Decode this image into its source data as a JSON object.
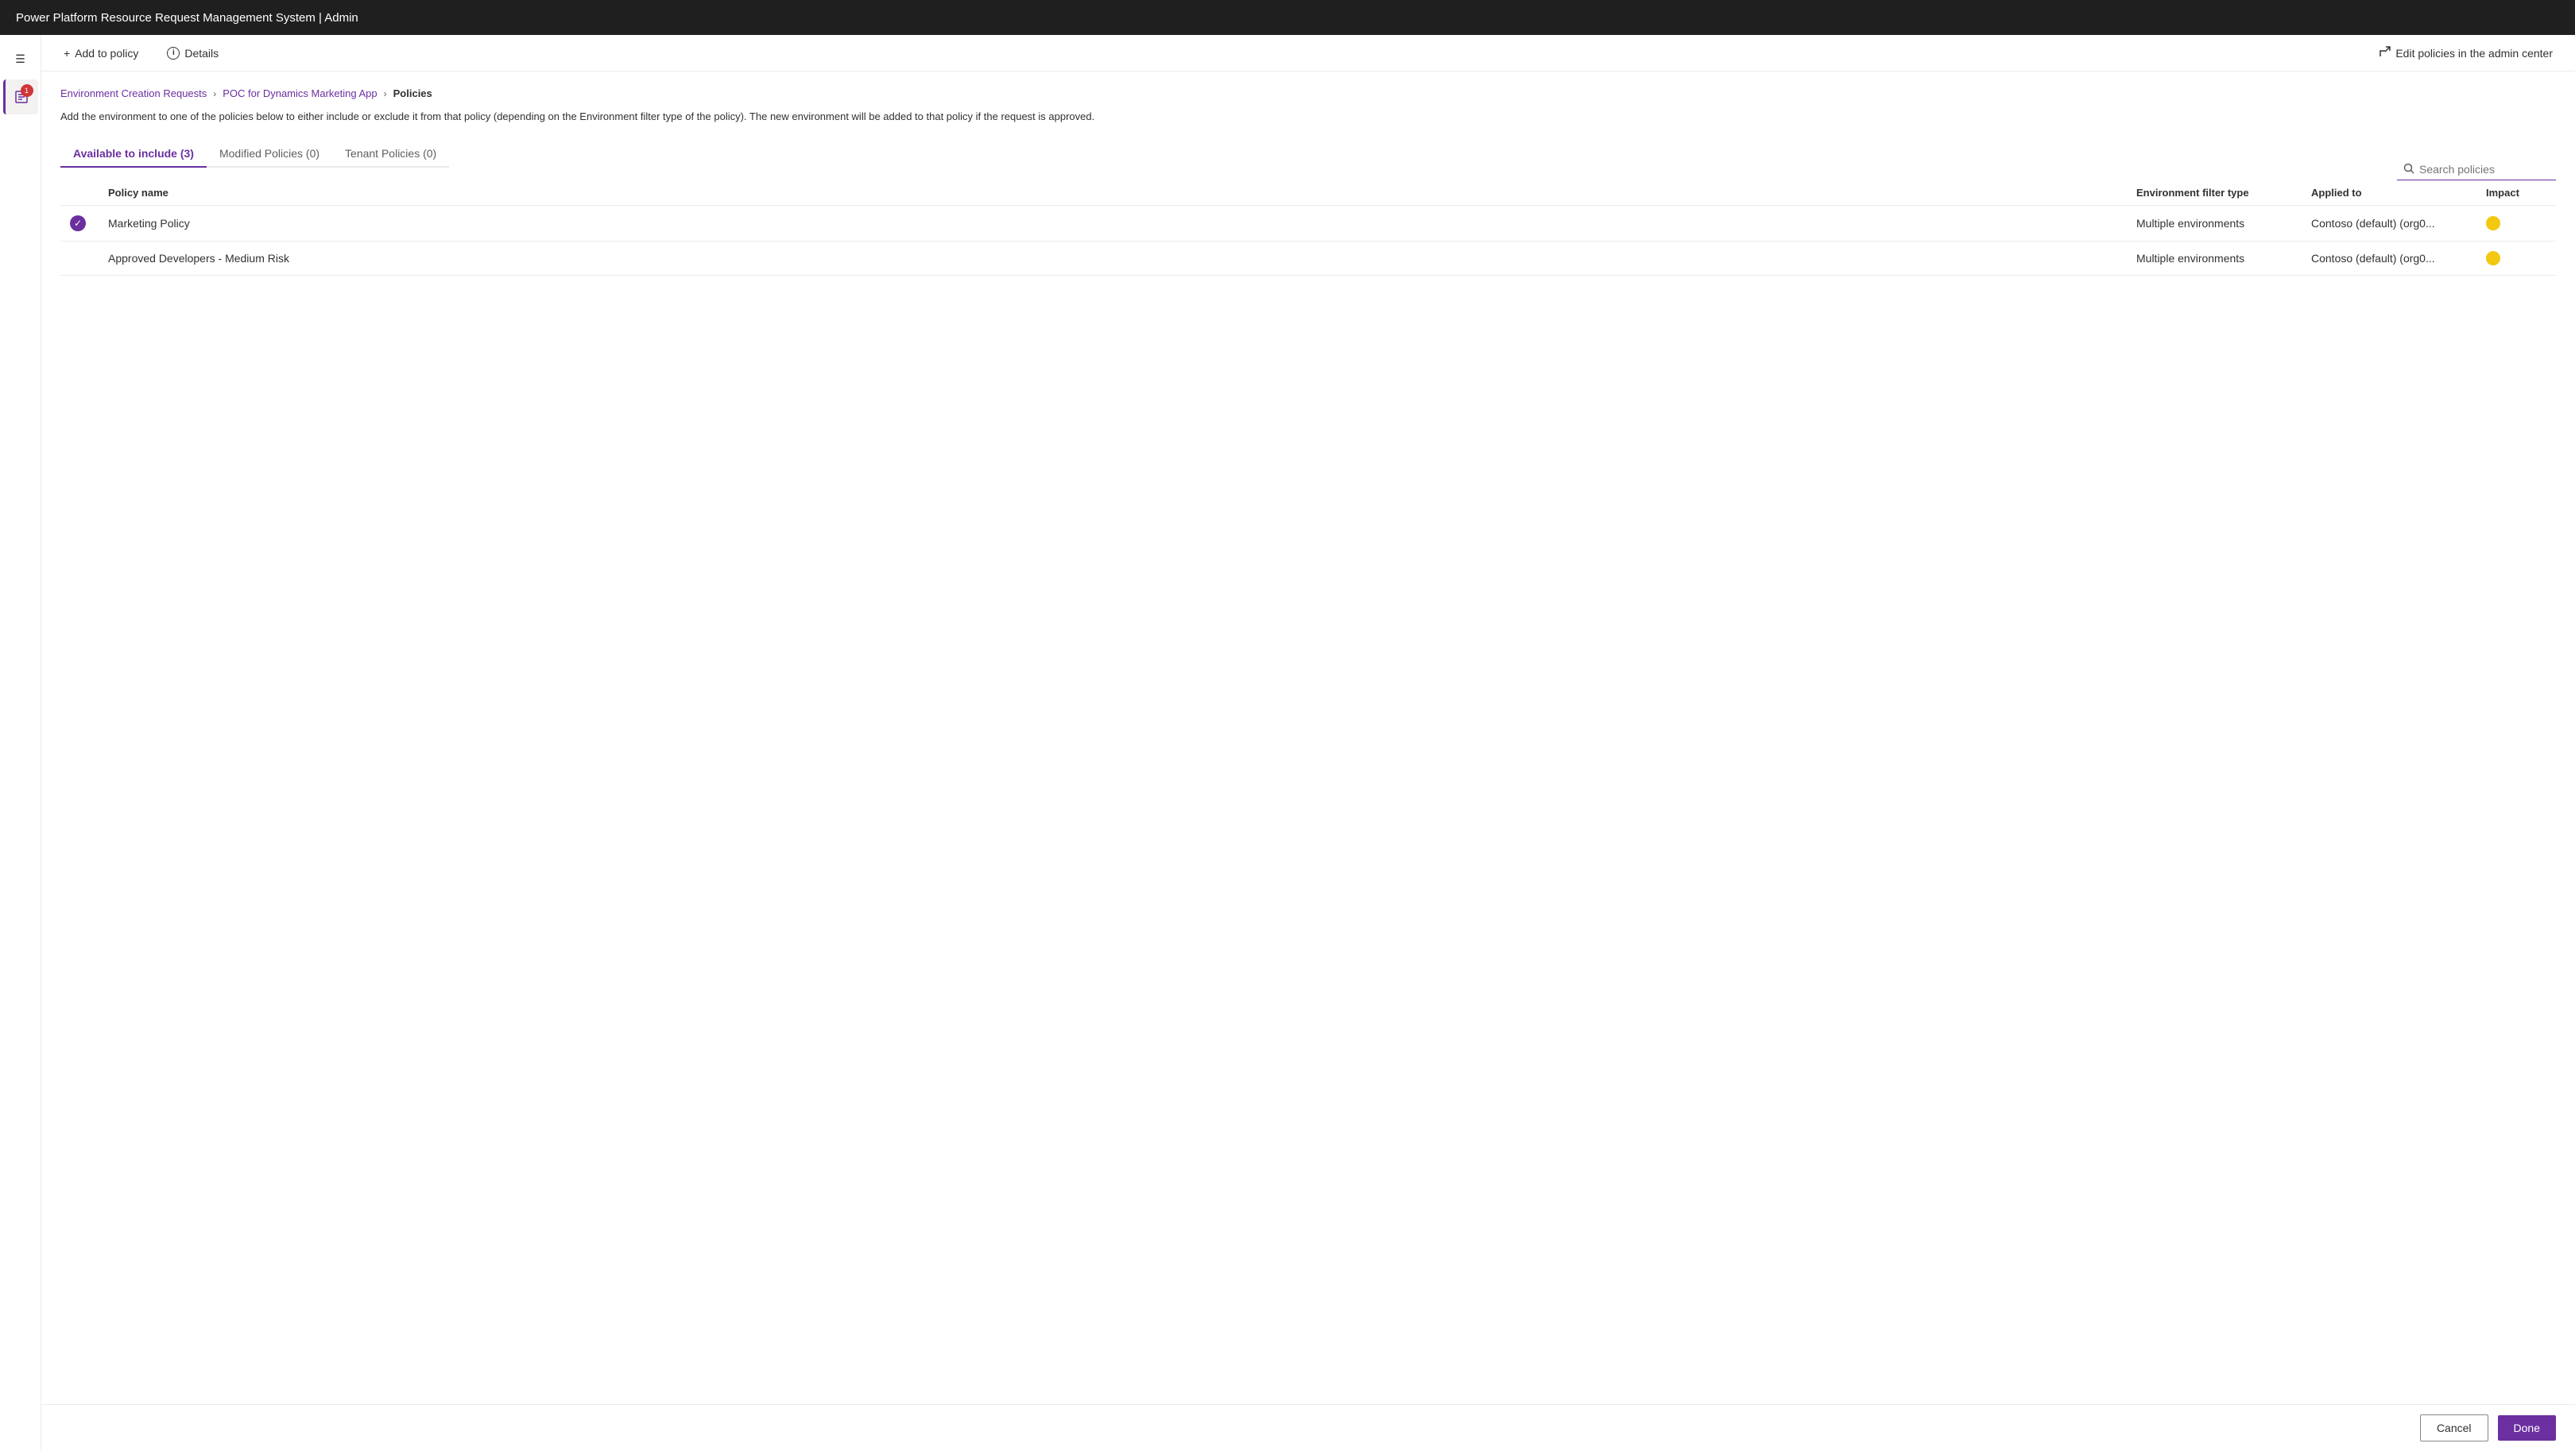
{
  "titleBar": {
    "title": "Power Platform Resource Request Management System | Admin"
  },
  "toolbar": {
    "addToPolicyLabel": "Add to policy",
    "detailsLabel": "Details",
    "editPoliciesLabel": "Edit policies in the admin center"
  },
  "breadcrumb": {
    "step1": "Environment Creation Requests",
    "step2": "POC for Dynamics Marketing App",
    "step3": "Policies"
  },
  "description": "Add the environment to one of the policies below to either include or exclude it from that policy (depending on the Environment filter type of the policy). The new environment will be added to that policy if the request is approved.",
  "tabs": [
    {
      "label": "Available to include (3)",
      "active": true
    },
    {
      "label": "Modified Policies (0)",
      "active": false
    },
    {
      "label": "Tenant Policies (0)",
      "active": false
    }
  ],
  "search": {
    "placeholder": "Search policies"
  },
  "table": {
    "columns": {
      "policyName": "Policy name",
      "filterType": "Environment filter type",
      "appliedTo": "Applied to",
      "impact": "Impact"
    },
    "rows": [
      {
        "selected": true,
        "policyName": "Marketing Policy",
        "filterType": "Multiple environments",
        "appliedTo": "Contoso (default) (org0...",
        "impactColor": "#f2c811"
      },
      {
        "selected": false,
        "policyName": "Approved Developers - Medium Risk",
        "filterType": "Multiple environments",
        "appliedTo": "Contoso (default) (org0...",
        "impactColor": "#f2c811"
      }
    ]
  },
  "footer": {
    "cancelLabel": "Cancel",
    "doneLabel": "Done"
  },
  "icons": {
    "hamburger": "☰",
    "plus": "+",
    "info": "ℹ",
    "externalLink": "⧉",
    "search": "🔍",
    "checkmark": "✓",
    "chevronRight": "›",
    "navIcon": "📋"
  }
}
